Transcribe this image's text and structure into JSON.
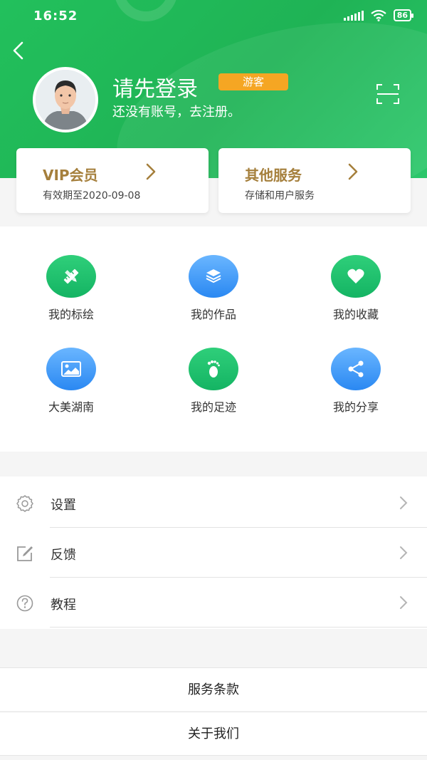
{
  "status_bar": {
    "time": "16:52",
    "battery": "86"
  },
  "profile": {
    "login_title": "请先登录",
    "guest_badge": "游客",
    "register_text": "还没有账号，去注册。"
  },
  "cards": [
    {
      "title": "VIP会员",
      "subtitle": "有效期至2020-09-08"
    },
    {
      "title": "其他服务",
      "subtitle": "存储和用户服务"
    }
  ],
  "grid": [
    {
      "label": "我的标绘",
      "icon": "pencil-ruler-icon",
      "color": "#1fb866"
    },
    {
      "label": "我的作品",
      "icon": "layers-icon",
      "color": "#3a92f5"
    },
    {
      "label": "我的收藏",
      "icon": "heart-icon",
      "color": "#1fb866"
    },
    {
      "label": "大美湖南",
      "icon": "image-icon",
      "color": "#3a92f5"
    },
    {
      "label": "我的足迹",
      "icon": "footprint-icon",
      "color": "#1fb866"
    },
    {
      "label": "我的分享",
      "icon": "share-icon",
      "color": "#3a92f5"
    }
  ],
  "menu": [
    {
      "label": "设置",
      "icon": "gear-icon"
    },
    {
      "label": "反馈",
      "icon": "edit-icon"
    },
    {
      "label": "教程",
      "icon": "help-icon"
    }
  ],
  "bottom_links": [
    {
      "label": "服务条款"
    },
    {
      "label": "关于我们"
    }
  ],
  "colors": {
    "header_green": "#22c05c",
    "gold": "#a57f3c",
    "badge_orange": "#f5a623",
    "icon_blue": "#3a92f5"
  }
}
